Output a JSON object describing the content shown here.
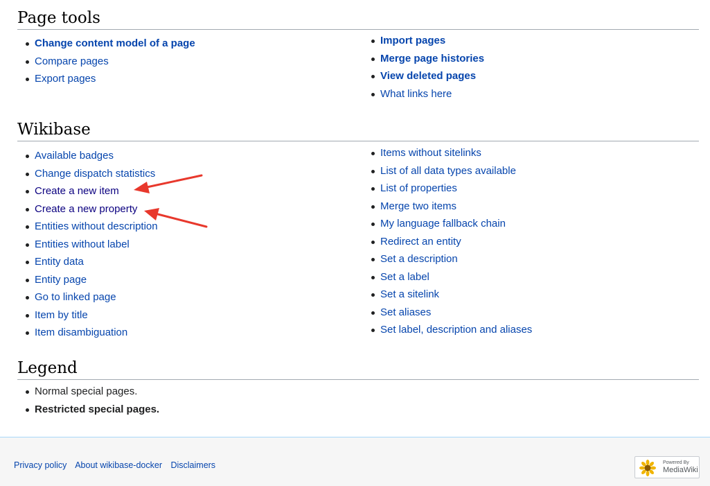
{
  "sections": {
    "page_tools": {
      "heading": "Page tools",
      "left": [
        {
          "label": "Change content model of a page"
        },
        {
          "label": "Compare pages"
        },
        {
          "label": "Export pages"
        }
      ],
      "right": [
        {
          "label": "Import pages"
        },
        {
          "label": "Merge page histories"
        },
        {
          "label": "View deleted pages"
        },
        {
          "label": "What links here"
        }
      ]
    },
    "wikibase": {
      "heading": "Wikibase",
      "left": [
        {
          "label": "Available badges"
        },
        {
          "label": "Change dispatch statistics"
        },
        {
          "label": "Create a new item"
        },
        {
          "label": "Create a new property"
        },
        {
          "label": "Entities without description"
        },
        {
          "label": "Entities without label"
        },
        {
          "label": "Entity data"
        },
        {
          "label": "Entity page"
        },
        {
          "label": "Go to linked page"
        },
        {
          "label": "Item by title"
        },
        {
          "label": "Item disambiguation"
        }
      ],
      "right": [
        {
          "label": "Items without sitelinks"
        },
        {
          "label": "List of all data types available"
        },
        {
          "label": "List of properties"
        },
        {
          "label": "Merge two items"
        },
        {
          "label": "My language fallback chain"
        },
        {
          "label": "Redirect an entity"
        },
        {
          "label": "Set a description"
        },
        {
          "label": "Set a label"
        },
        {
          "label": "Set a sitelink"
        },
        {
          "label": "Set aliases"
        },
        {
          "label": "Set label, description and aliases"
        }
      ]
    },
    "legend": {
      "heading": "Legend",
      "items": [
        {
          "label": "Normal special pages."
        },
        {
          "label": "Restricted special pages."
        }
      ]
    }
  },
  "footer": {
    "links": [
      {
        "label": "Privacy policy"
      },
      {
        "label": "About wikibase-docker"
      },
      {
        "label": "Disclaimers"
      }
    ],
    "badge": {
      "small": "Powered By",
      "large": "MediaWiki"
    }
  },
  "colors": {
    "link": "#0645ad",
    "visited_link": "#0b0080",
    "annotation_arrow": "#e8382c"
  }
}
